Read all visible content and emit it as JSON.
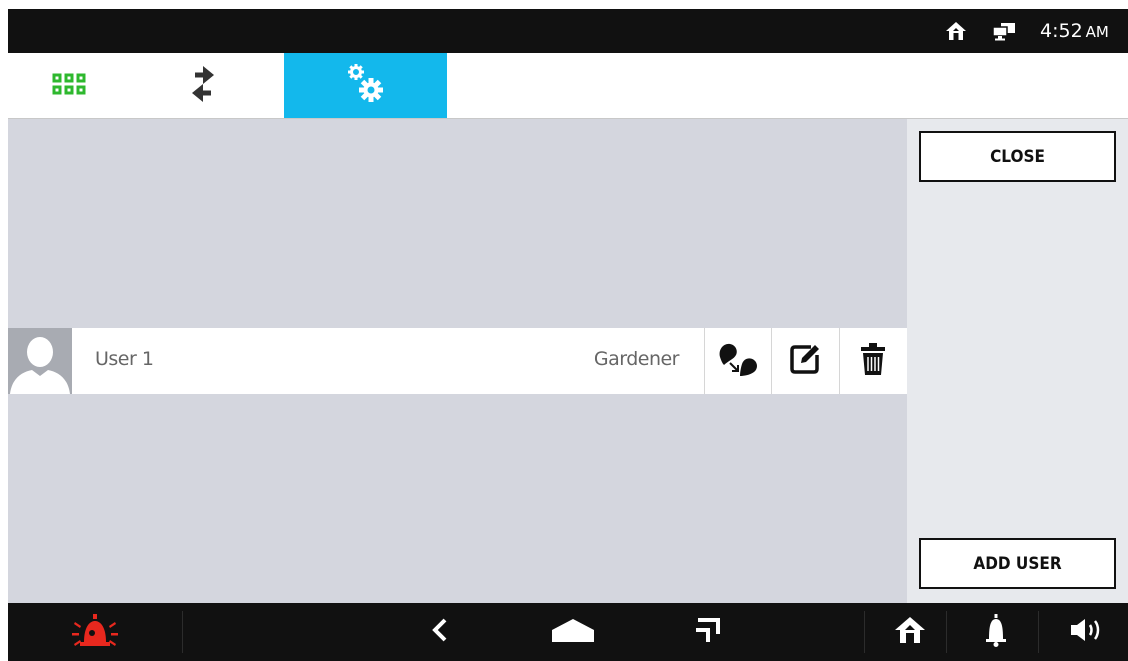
{
  "statusbar": {
    "time": "4:52",
    "ampm": "AM",
    "icons": [
      "home-icon",
      "network-icon"
    ]
  },
  "tabs": [
    {
      "name": "apps",
      "icon": "apps-grid-icon",
      "active": false
    },
    {
      "name": "transfer",
      "icon": "transfer-arrows-icon",
      "active": false
    },
    {
      "name": "settings",
      "icon": "settings-gears-icon",
      "active": true
    }
  ],
  "user_list": [
    {
      "name": "User 1",
      "role": "Gardener",
      "actions": [
        "assign-icon",
        "edit-icon",
        "trash-icon"
      ]
    }
  ],
  "side_panel": {
    "close_label": "CLOSE",
    "add_user_label": "ADD USER"
  },
  "navbar": {
    "icons": [
      "alarm-icon",
      "back-icon",
      "home-icon",
      "recent-apps-icon",
      "home-icon",
      "bell-icon",
      "volume-icon"
    ]
  },
  "colors": {
    "accent": "#13b8ec",
    "apps_icon": "#2eb82e",
    "alarm": "#e8281e",
    "status_bar": "#111111",
    "content_bg": "#d4d6de",
    "side_panel_bg": "#e7e9ed"
  }
}
